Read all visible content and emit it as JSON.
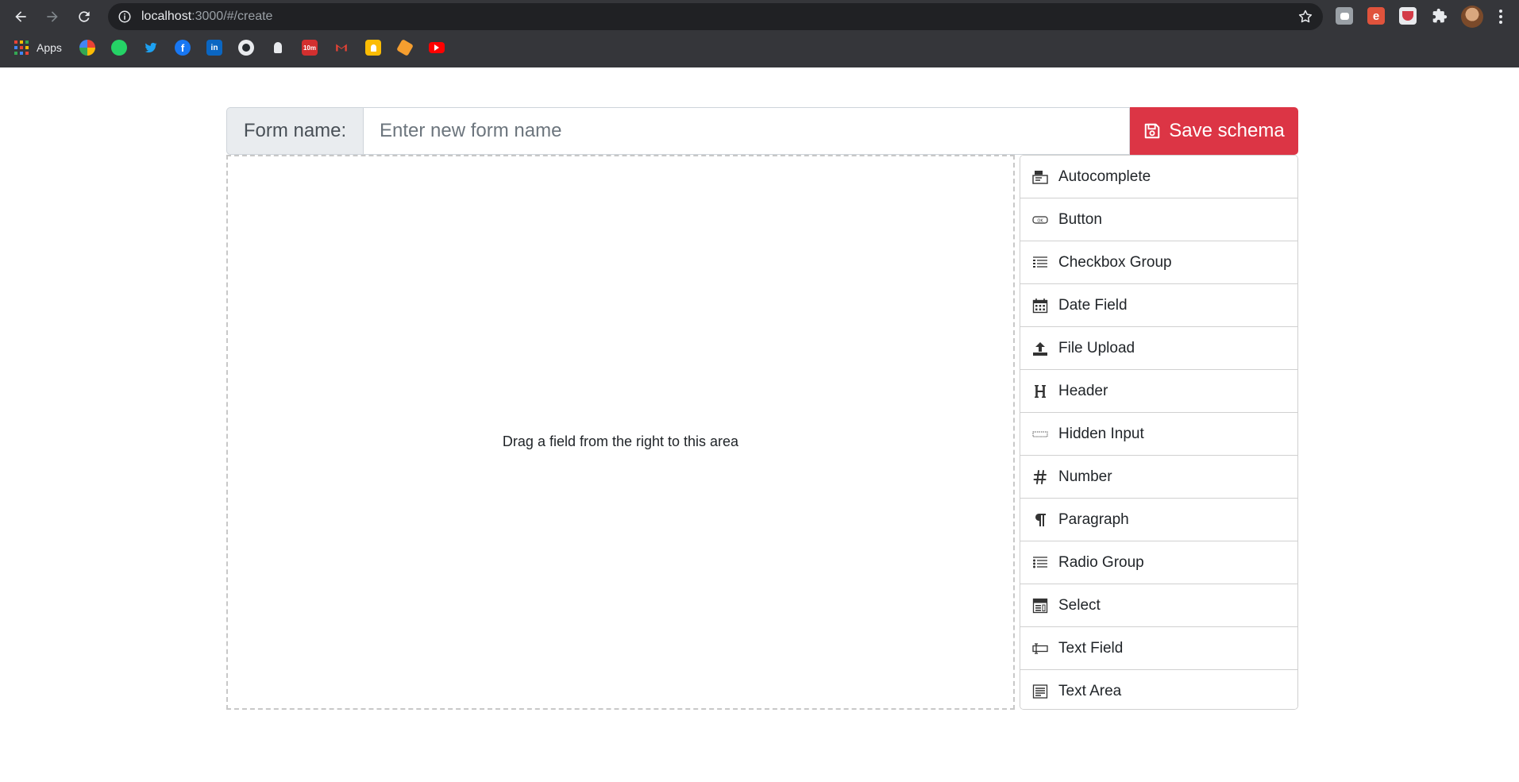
{
  "browser": {
    "url_host": "localhost",
    "url_path": ":3000/#/create",
    "bookmarks_apps_label": "Apps"
  },
  "form": {
    "name_label": "Form name:",
    "name_placeholder": "Enter new form name",
    "save_label": "Save schema",
    "accent_color": "#dc3545"
  },
  "drop_area": {
    "hint": "Drag a field from the right to this area"
  },
  "fields": [
    {
      "label": "Autocomplete",
      "icon": "autocomplete-icon"
    },
    {
      "label": "Button",
      "icon": "button-icon"
    },
    {
      "label": "Checkbox Group",
      "icon": "checkbox-group-icon"
    },
    {
      "label": "Date Field",
      "icon": "calendar-icon"
    },
    {
      "label": "File Upload",
      "icon": "upload-icon"
    },
    {
      "label": "Header",
      "icon": "header-icon"
    },
    {
      "label": "Hidden Input",
      "icon": "hidden-input-icon"
    },
    {
      "label": "Number",
      "icon": "hash-icon"
    },
    {
      "label": "Paragraph",
      "icon": "paragraph-icon"
    },
    {
      "label": "Radio Group",
      "icon": "radio-group-icon"
    },
    {
      "label": "Select",
      "icon": "select-icon"
    },
    {
      "label": "Text Field",
      "icon": "text-field-icon"
    },
    {
      "label": "Text Area",
      "icon": "text-area-icon"
    }
  ]
}
